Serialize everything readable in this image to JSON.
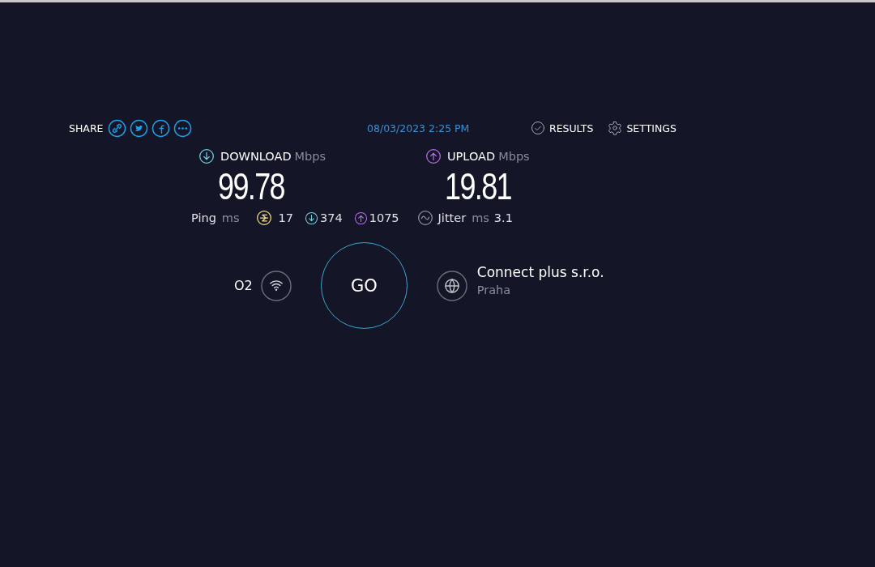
{
  "share": {
    "label": "SHARE"
  },
  "datetime": "08/03/2023 2:25 PM",
  "nav": [
    {
      "label": "RESULTS",
      "kind": "results"
    },
    {
      "label": "SETTINGS",
      "kind": "settings"
    }
  ],
  "download": {
    "label": "DOWNLOAD",
    "unit": "Mbps",
    "value": "99.78"
  },
  "upload": {
    "label": "UPLOAD",
    "unit": "Mbps",
    "value": "19.81"
  },
  "ping": {
    "label": "Ping",
    "unit": "ms",
    "idle": "17",
    "down": "374",
    "up": "1075"
  },
  "jitter": {
    "label": "Jitter",
    "unit": "ms",
    "value": "3.1"
  },
  "provider": "O2",
  "go": "GO",
  "server": {
    "name": "Connect plus s.r.o.",
    "location": "Praha"
  }
}
